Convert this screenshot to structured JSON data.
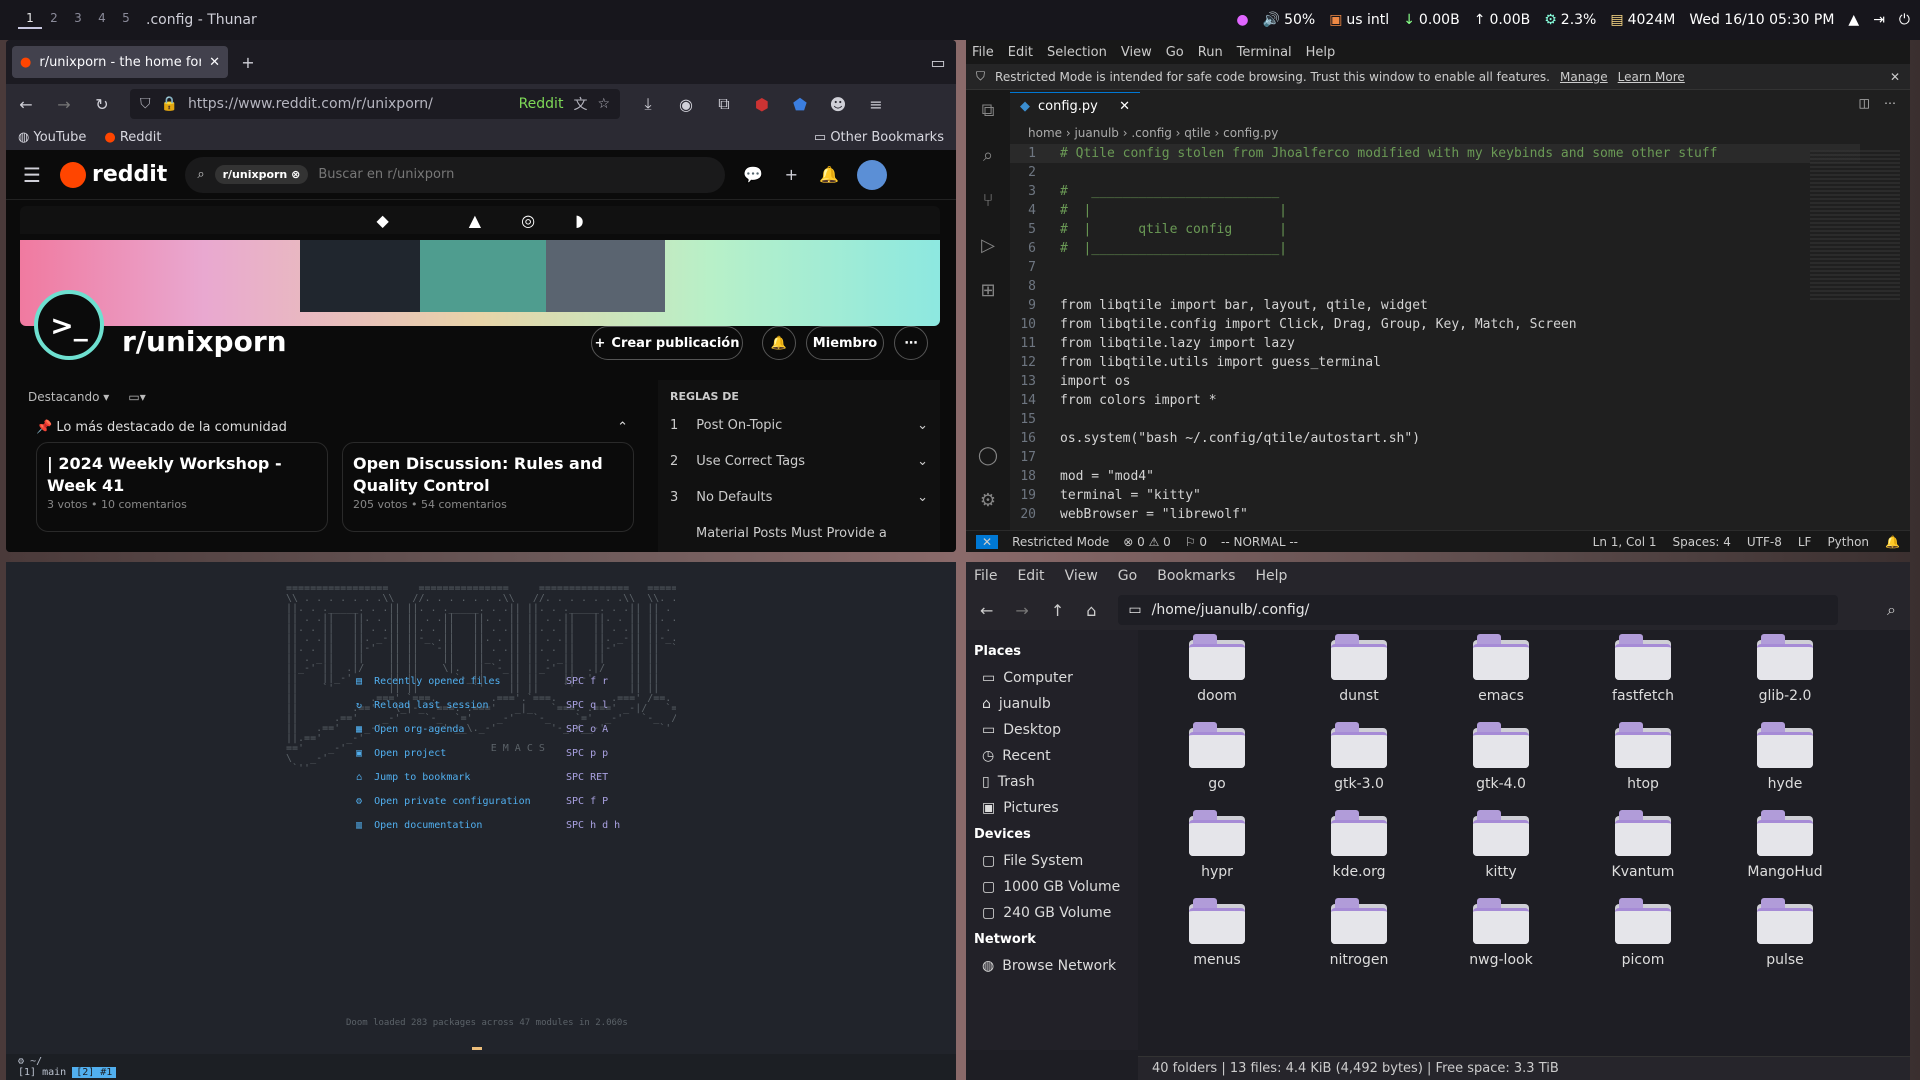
{
  "topbar": {
    "workspaces": [
      "1",
      "2",
      "3",
      "4",
      "5"
    ],
    "title": ".config - Thunar",
    "tray": {
      "volume": "50%",
      "keyboard": "us intl",
      "down": "0.00B",
      "up": "0.00B",
      "cpu": "2.3%",
      "mem": "4024M",
      "clock": "Wed 16/10 05:30 PM"
    }
  },
  "browser": {
    "tab_title": "r/unixporn - the home for *N",
    "url": "https://www.reddit.com/r/unixporn/",
    "url_badge": "Reddit",
    "bookmarks": [
      "YouTube",
      "Reddit"
    ],
    "other_bookmarks": "Other Bookmarks",
    "reddit": {
      "logo": "reddit",
      "search_chip": "r/unixporn",
      "search_placeholder": "Buscar en r/unixporn",
      "subreddit": "r/unixporn",
      "btn_create": "Crear publicación",
      "btn_member": "Miembro",
      "sort": "Destacando",
      "highlight": "Lo más destacado de la comunidad",
      "cards": [
        {
          "title": "| 2024 Weekly Workshop - Week 41",
          "meta": "3 votos • 10 comentarios"
        },
        {
          "title": "Open Discussion: Rules and Quality Control",
          "meta": "205 votos • 54 comentarios"
        }
      ],
      "rules_title": "REGLAS DE",
      "rules": [
        {
          "n": "1",
          "t": "Post On-Topic"
        },
        {
          "n": "2",
          "t": "Use Correct Tags"
        },
        {
          "n": "3",
          "t": "No Defaults"
        },
        {
          "n": "",
          "t": "Material Posts Must Provide a"
        }
      ]
    }
  },
  "emacs": {
    "banner": "EMACS",
    "menu": [
      {
        "label": "Recently opened files",
        "key": "SPC f r"
      },
      {
        "label": "Reload last session",
        "key": "SPC q l"
      },
      {
        "label": "Open org-agenda",
        "key": "SPC o A"
      },
      {
        "label": "Open project",
        "key": "SPC p p"
      },
      {
        "label": "Jump to bookmark",
        "key": "SPC RET"
      },
      {
        "label": "Open private configuration",
        "key": "SPC f P"
      },
      {
        "label": "Open documentation",
        "key": "SPC h d h"
      }
    ],
    "footer": "Doom loaded 283 packages across 47 modules in 2.060s",
    "modeline1": "~/",
    "modeline2": "[1] main",
    "modeline_tag": "[2] #1"
  },
  "vscode": {
    "menu": [
      "File",
      "Edit",
      "Selection",
      "View",
      "Go",
      "Run",
      "Terminal",
      "Help"
    ],
    "restricted": "Restricted Mode is intended for safe code browsing. Trust this window to enable all features.",
    "manage": "Manage",
    "learn": "Learn More",
    "tab": "config.py",
    "crumbs": "home  ›  juanulb  ›  .config  ›  qtile  ›  config.py",
    "lines": [
      {
        "n": "1",
        "t": "# Qtile config stolen from Jhoalferco modified with my keybinds and some other stuff",
        "c": "#6a9955"
      },
      {
        "n": "2",
        "t": "",
        "c": "#ccc"
      },
      {
        "n": "3",
        "t": "#   ________________________",
        "c": "#6a9955"
      },
      {
        "n": "4",
        "t": "#  |                        |",
        "c": "#6a9955"
      },
      {
        "n": "5",
        "t": "#  |      qtile config      |",
        "c": "#6a9955"
      },
      {
        "n": "6",
        "t": "#  |________________________|",
        "c": "#6a9955"
      },
      {
        "n": "7",
        "t": "",
        "c": "#ccc"
      },
      {
        "n": "8",
        "t": "",
        "c": "#ccc"
      },
      {
        "n": "9",
        "t": "from libqtile import bar, layout, qtile, widget",
        "c": "#d4d4d4"
      },
      {
        "n": "10",
        "t": "from libqtile.config import Click, Drag, Group, Key, Match, Screen",
        "c": "#d4d4d4"
      },
      {
        "n": "11",
        "t": "from libqtile.lazy import lazy",
        "c": "#d4d4d4"
      },
      {
        "n": "12",
        "t": "from libqtile.utils import guess_terminal",
        "c": "#d4d4d4"
      },
      {
        "n": "13",
        "t": "import os",
        "c": "#d4d4d4"
      },
      {
        "n": "14",
        "t": "from colors import *",
        "c": "#d4d4d4"
      },
      {
        "n": "15",
        "t": "",
        "c": "#ccc"
      },
      {
        "n": "16",
        "t": "os.system(\"bash ~/.config/qtile/autostart.sh\")",
        "c": "#d4d4d4"
      },
      {
        "n": "17",
        "t": "",
        "c": "#ccc"
      },
      {
        "n": "18",
        "t": "mod = \"mod4\"",
        "c": "#d4d4d4"
      },
      {
        "n": "19",
        "t": "terminal = \"kitty\"",
        "c": "#d4d4d4"
      },
      {
        "n": "20",
        "t": "webBrowser = \"librewolf\"",
        "c": "#d4d4d4"
      }
    ],
    "status": {
      "mode": "Restricted Mode",
      "errors": "⊗ 0 ⚠ 0",
      "ports": "⚐ 0",
      "vim": "-- NORMAL --",
      "pos": "Ln 1, Col 1",
      "spaces": "Spaces: 4",
      "enc": "UTF-8",
      "eol": "LF",
      "lang": "Python"
    }
  },
  "thunar": {
    "menu": [
      "File",
      "Edit",
      "View",
      "Go",
      "Bookmarks",
      "Help"
    ],
    "path": "/home/juanulb/.config/",
    "places_title": "Places",
    "places": [
      "Computer",
      "juanulb",
      "Desktop",
      "Recent",
      "Trash",
      "Pictures"
    ],
    "devices_title": "Devices",
    "devices": [
      "File System",
      "1000 GB Volume",
      "240 GB Volume"
    ],
    "network_title": "Network",
    "network": [
      "Browse Network"
    ],
    "folders": [
      "doom",
      "dunst",
      "emacs",
      "fastfetch",
      "glib-2.0",
      "go",
      "gtk-3.0",
      "gtk-4.0",
      "htop",
      "hyde",
      "hypr",
      "kde.org",
      "kitty",
      "Kvantum",
      "MangoHud",
      "menus",
      "nitrogen",
      "nwg-look",
      "picom",
      "pulse"
    ],
    "status": "40 folders  |  13 files: 4.4 KiB (4,492 bytes)  |  Free space: 3.3 TiB"
  }
}
